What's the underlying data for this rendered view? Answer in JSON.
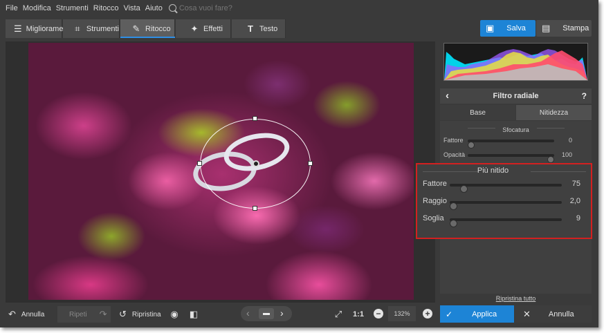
{
  "menu": {
    "items": [
      "File",
      "Modifica",
      "Strumenti",
      "Ritocco",
      "Vista",
      "Aiuto"
    ],
    "search_placeholder": "Cosa vuoi fare?"
  },
  "toolbar": {
    "tabs": [
      {
        "label": "Miglioramento",
        "icon": "sliders-icon"
      },
      {
        "label": "Strumenti",
        "icon": "crop-icon"
      },
      {
        "label": "Ritocco",
        "icon": "brush-icon",
        "active": true
      },
      {
        "label": "Effetti",
        "icon": "magic-wand-icon"
      },
      {
        "label": "Testo",
        "icon": "text-icon"
      }
    ],
    "save_label": "Salva",
    "print_label": "Stampa",
    "accent_color": "#1d84d6"
  },
  "panel": {
    "title": "Filtro radiale",
    "help": "?",
    "subtabs": [
      "Base",
      "Nitidezza"
    ],
    "active_subtab": "Nitidezza",
    "blur_section": {
      "title": "Sfocatura",
      "sliders": [
        {
          "label": "Fattore",
          "value": "0",
          "fraction": 0.0
        },
        {
          "label": "Opacità",
          "value": "100",
          "fraction": 1.0
        }
      ]
    },
    "sharpen_section": {
      "title": "Più nitido",
      "sliders": [
        {
          "label": "Fattore",
          "value": "75",
          "fraction": 0.1
        },
        {
          "label": "Raggio",
          "value": "2,0",
          "fraction": 0.0
        },
        {
          "label": "Soglia",
          "value": "9",
          "fraction": 0.0
        }
      ]
    },
    "reset_all": "Ripristina tutto"
  },
  "bottom": {
    "undo_label": "Annulla",
    "redo_label": "Ripeti",
    "reset_label": "Ripristina",
    "zoom_one_to_one": "1:1",
    "zoom_value": "132%",
    "apply_label": "Applica",
    "cancel_label": "Annulla"
  }
}
